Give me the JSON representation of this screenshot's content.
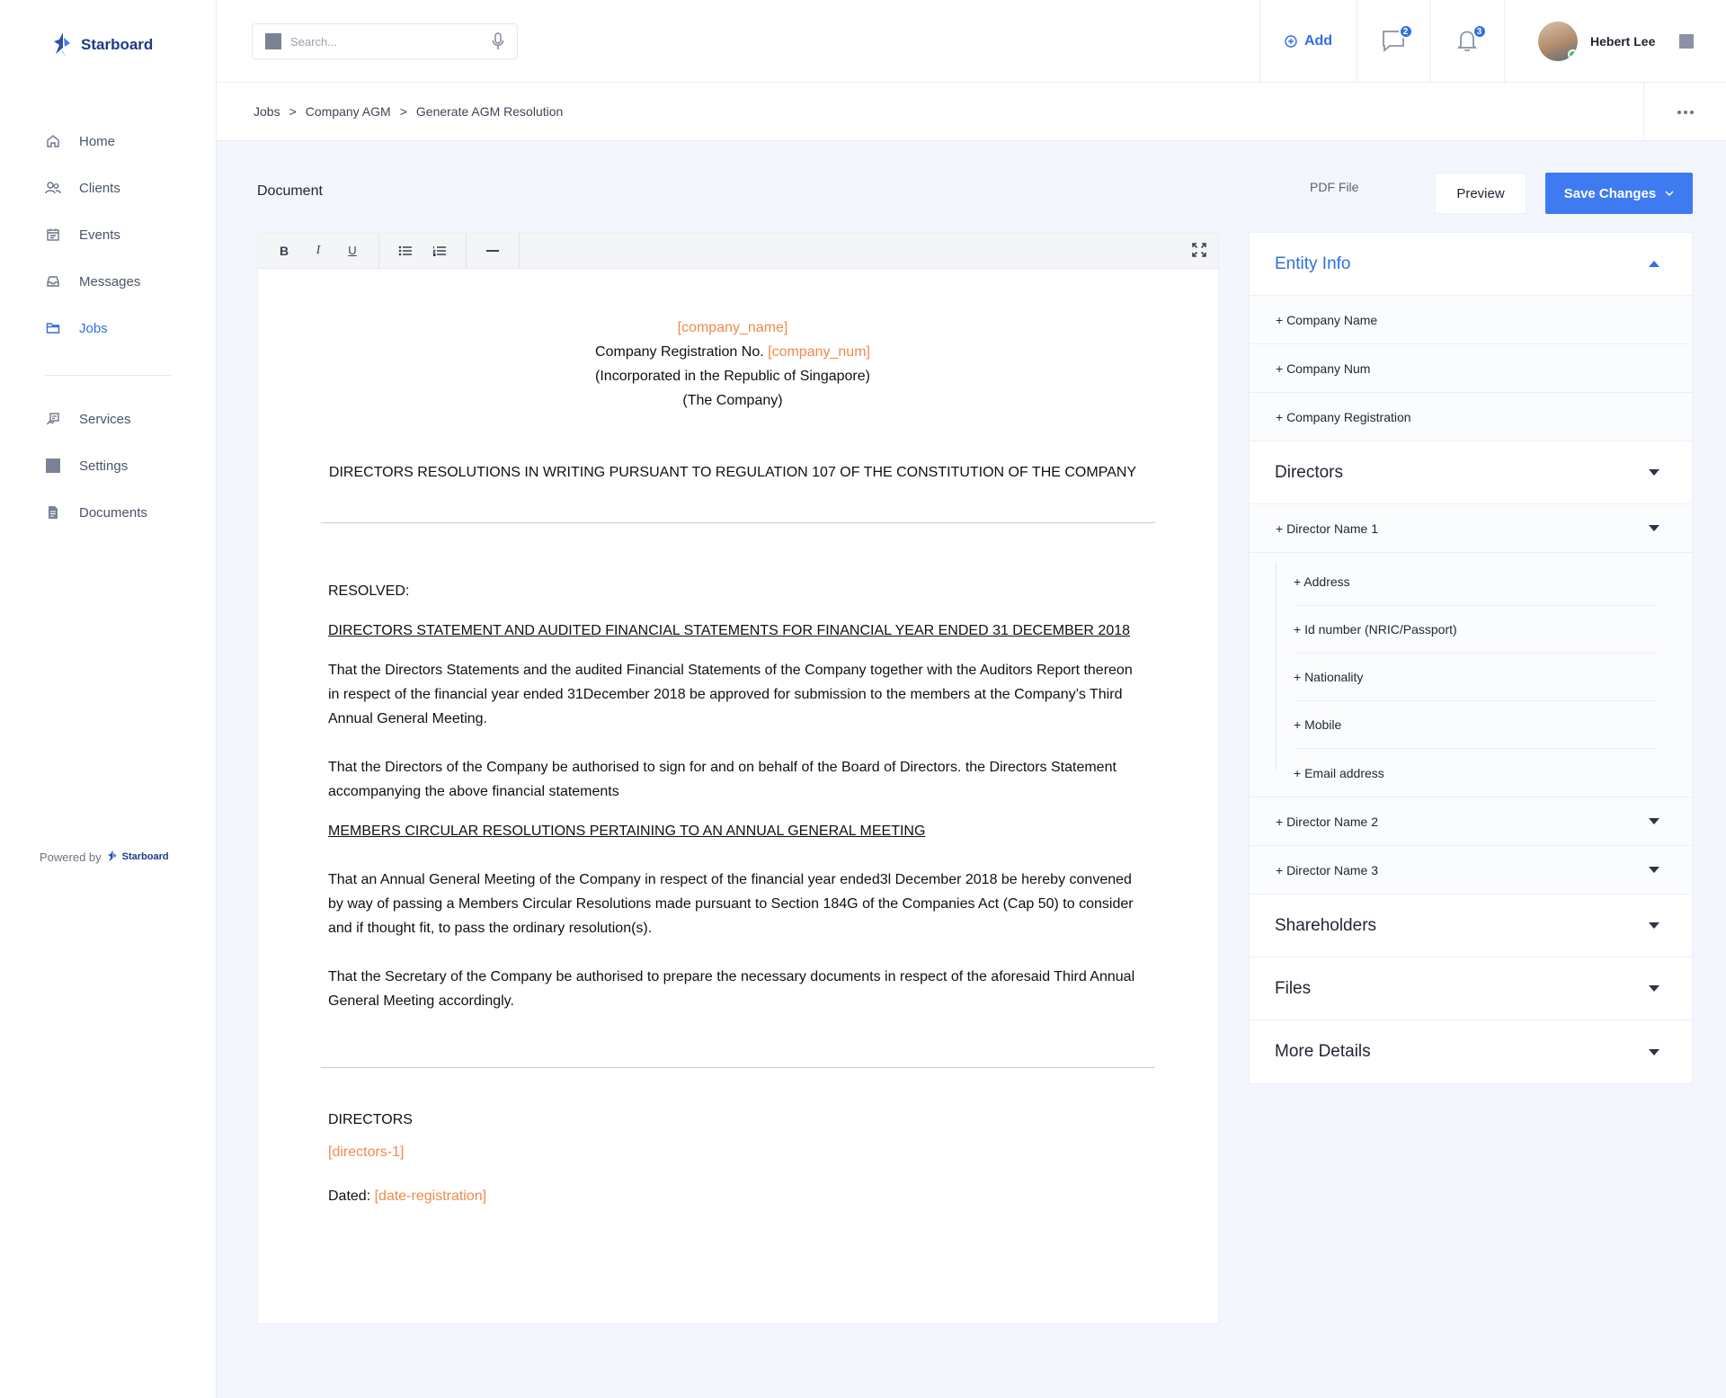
{
  "brand": {
    "name": "Starboard"
  },
  "sidebar": {
    "items": [
      {
        "label": "Home",
        "icon": "home-icon"
      },
      {
        "label": "Clients",
        "icon": "users-icon"
      },
      {
        "label": "Events",
        "icon": "calendar-icon"
      },
      {
        "label": "Messages",
        "icon": "inbox-icon"
      },
      {
        "label": "Jobs",
        "icon": "folder-icon",
        "active": true
      }
    ],
    "items2": [
      {
        "label": "Services",
        "icon": "services-icon"
      },
      {
        "label": "Settings",
        "icon": "settings-icon"
      },
      {
        "label": "Documents",
        "icon": "document-icon"
      }
    ],
    "powered_by": "Powered by",
    "powered_brand": "Starboard"
  },
  "header": {
    "search_placeholder": "Search...",
    "add_label": "Add",
    "messages_count": "2",
    "notifications_count": "3",
    "user_name": "Hebert Lee"
  },
  "breadcrumb": [
    "Jobs",
    ">",
    "Company AGM",
    ">",
    "Generate AGM Resolution"
  ],
  "page": {
    "doc_label": "Document",
    "pdf_label": "PDF File",
    "preview_label": "Preview",
    "save_label": "Save Changes"
  },
  "toolbar": {
    "bold": "B",
    "italic": "I",
    "underline": "U"
  },
  "document": {
    "company_name_ph": "[company_name]",
    "reg_prefix": "Company Registration No. ",
    "company_num_ph": "[company_num]",
    "incorporated": "(Incorporated in the Republic of Singapore)",
    "the_company": "(The Company)",
    "heading": "DIRECTORS RESOLUTIONS IN WRITING PURSUANT TO REGULATION 107 OF THE CONSTITUTION OF THE COMPANY",
    "resolved": "RESOLVED:",
    "sub1": "DIRECTORS STATEMENT AND AUDITED FINANCIAL STATEMENTS FOR FINANCIAL YEAR ENDED 31 DECEMBER 2018",
    "p1": "That the Directors Statements and the audited Financial Statements of the Company together with the Auditors Report thereon in respect of the financial year ended 31December 2018 be approved for submission to the members at the Company’s Third Annual General Meeting.",
    "p2": "That the Directors of the Company be authorised to sign for and on behalf of the Board of Directors. the Directors Statement accompanying the above financial statements",
    "sub2": "MEMBERS CIRCULAR RESOLUTIONS PERTAINING TO AN ANNUAL GENERAL MEETING",
    "p3": "That an Annual General Meeting of the Company in respect of the financial year ended3l December 2018 be hereby convened by way of passing a Members Circular Resolutions made pursuant to Section 184G of the Companies Act (Cap 50) to consider and if thought fit, to pass the ordinary resolution(s).",
    "p4": "That the Secretary of the Company be authorised to prepare the necessary documents in respect of the aforesaid Third Annual General Meeting accordingly.",
    "directors_label": "DIRECTORS",
    "directors_ph": "[directors-1]",
    "dated_label": "Dated: ",
    "date_ph": "[date-registration]"
  },
  "panel": {
    "entity_info": "Entity Info",
    "entity_fields": [
      "+  Company Name",
      "+  Company Num",
      "+  Company Registration"
    ],
    "directors": "Directors",
    "director1": "+  Director Name 1",
    "director1_fields": [
      "+  Address",
      "+ Id number (NRIC/Passport)",
      "+ Nationality",
      "+ Mobile",
      "+ Email address"
    ],
    "director2": "+  Director Name 2",
    "director3": "+  Director Name 3",
    "shareholders": "Shareholders",
    "files": "Files",
    "more_details": "More Details"
  },
  "colors": {
    "accent": "#2f6fe4",
    "placeholder": "#f08a4b",
    "save": "#3f7bf0"
  }
}
